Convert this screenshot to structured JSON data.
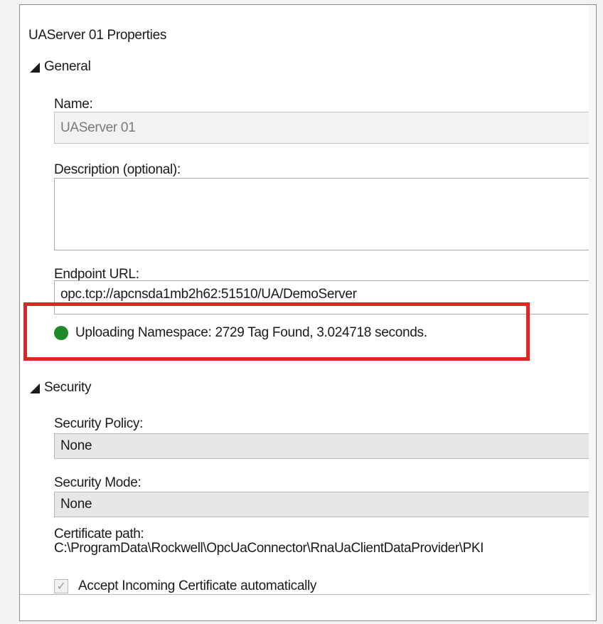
{
  "panel": {
    "title": "UAServer 01  Properties"
  },
  "general": {
    "heading": "General",
    "name_label": "Name:",
    "name_value": "UAServer 01",
    "description_label": "Description (optional):",
    "description_value": "",
    "endpoint_label": "Endpoint URL:",
    "endpoint_value": "opc.tcp://apcnsda1mb2h62:51510/UA/DemoServer",
    "status_text": "Uploading Namespace: 2729 Tag Found, 3.024718 seconds.",
    "status_color": "#1e8a2a"
  },
  "security": {
    "heading": "Security",
    "policy_label": "Security Policy:",
    "policy_value": "None",
    "mode_label": "Security Mode:",
    "mode_value": "None",
    "cert_label": "Certificate path:",
    "cert_value": "C:\\ProgramData\\Rockwell\\OpcUaConnector\\RnaUaClientDataProvider\\PKI",
    "accept_label": "Accept Incoming Certificate automatically",
    "accept_checked": true
  },
  "highlight_color": "#e02525",
  "icons": [
    "collapse-triangle-icon",
    "status-dot-icon",
    "checkmark-icon"
  ]
}
